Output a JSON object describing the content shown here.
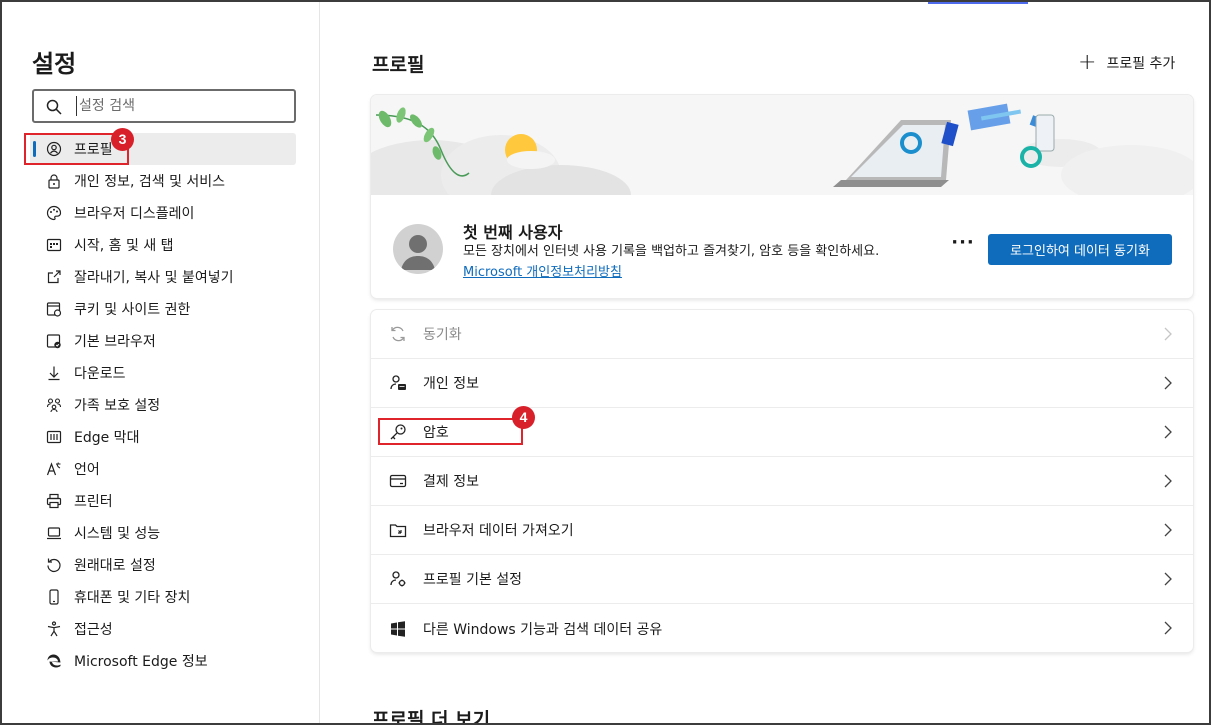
{
  "sidebar": {
    "title": "설정",
    "search_placeholder": "설정 검색",
    "items": [
      {
        "label": "프로필",
        "icon": "profile-icon"
      },
      {
        "label": "개인 정보, 검색 및 서비스",
        "icon": "lock-icon"
      },
      {
        "label": "브라우저 디스플레이",
        "icon": "palette-icon"
      },
      {
        "label": "시작, 홈 및 새 탭",
        "icon": "home-grid-icon"
      },
      {
        "label": "잘라내기, 복사 및 붙여넣기",
        "icon": "share-icon"
      },
      {
        "label": "쿠키 및 사이트 권한",
        "icon": "cookie-icon"
      },
      {
        "label": "기본 브라우저",
        "icon": "browser-check-icon"
      },
      {
        "label": "다운로드",
        "icon": "download-icon"
      },
      {
        "label": "가족 보호 설정",
        "icon": "family-icon"
      },
      {
        "label": "Edge 막대",
        "icon": "edge-bar-icon"
      },
      {
        "label": "언어",
        "icon": "language-icon"
      },
      {
        "label": "프린터",
        "icon": "printer-icon"
      },
      {
        "label": "시스템 및 성능",
        "icon": "laptop-icon"
      },
      {
        "label": "원래대로 설정",
        "icon": "reset-icon"
      },
      {
        "label": "휴대폰 및 기타 장치",
        "icon": "phone-icon"
      },
      {
        "label": "접근성",
        "icon": "accessibility-icon"
      },
      {
        "label": "Microsoft Edge 정보",
        "icon": "edge-logo-icon"
      }
    ]
  },
  "main": {
    "title": "프로필",
    "add_profile": "프로필 추가",
    "profile": {
      "name": "첫 번째 사용자",
      "description": "모든 장치에서 인터넷 사용 기록을 백업하고 즐겨찾기, 암호 등을 확인하세요.",
      "privacy_link": "Microsoft 개인정보처리방침",
      "more": "···",
      "sync_button": "로그인하여 데이터 동기화"
    },
    "rows": [
      {
        "label": "동기화",
        "icon": "sync-icon",
        "disabled": true
      },
      {
        "label": "개인 정보",
        "icon": "personal-info-icon"
      },
      {
        "label": "암호",
        "icon": "key-icon"
      },
      {
        "label": "결제 정보",
        "icon": "card-icon"
      },
      {
        "label": "브라우저 데이터 가져오기",
        "icon": "import-icon"
      },
      {
        "label": "프로필 기본 설정",
        "icon": "profile-settings-icon"
      },
      {
        "label": "다른 Windows 기능과 검색 데이터 공유",
        "icon": "windows-icon"
      }
    ],
    "more_title": "프로필 더 보기"
  },
  "annotations": {
    "badge_3": "3",
    "badge_4": "4",
    "color": "#e0242c"
  },
  "colors": {
    "accent": "#0f6cbd",
    "annotation": "#d8202a"
  }
}
